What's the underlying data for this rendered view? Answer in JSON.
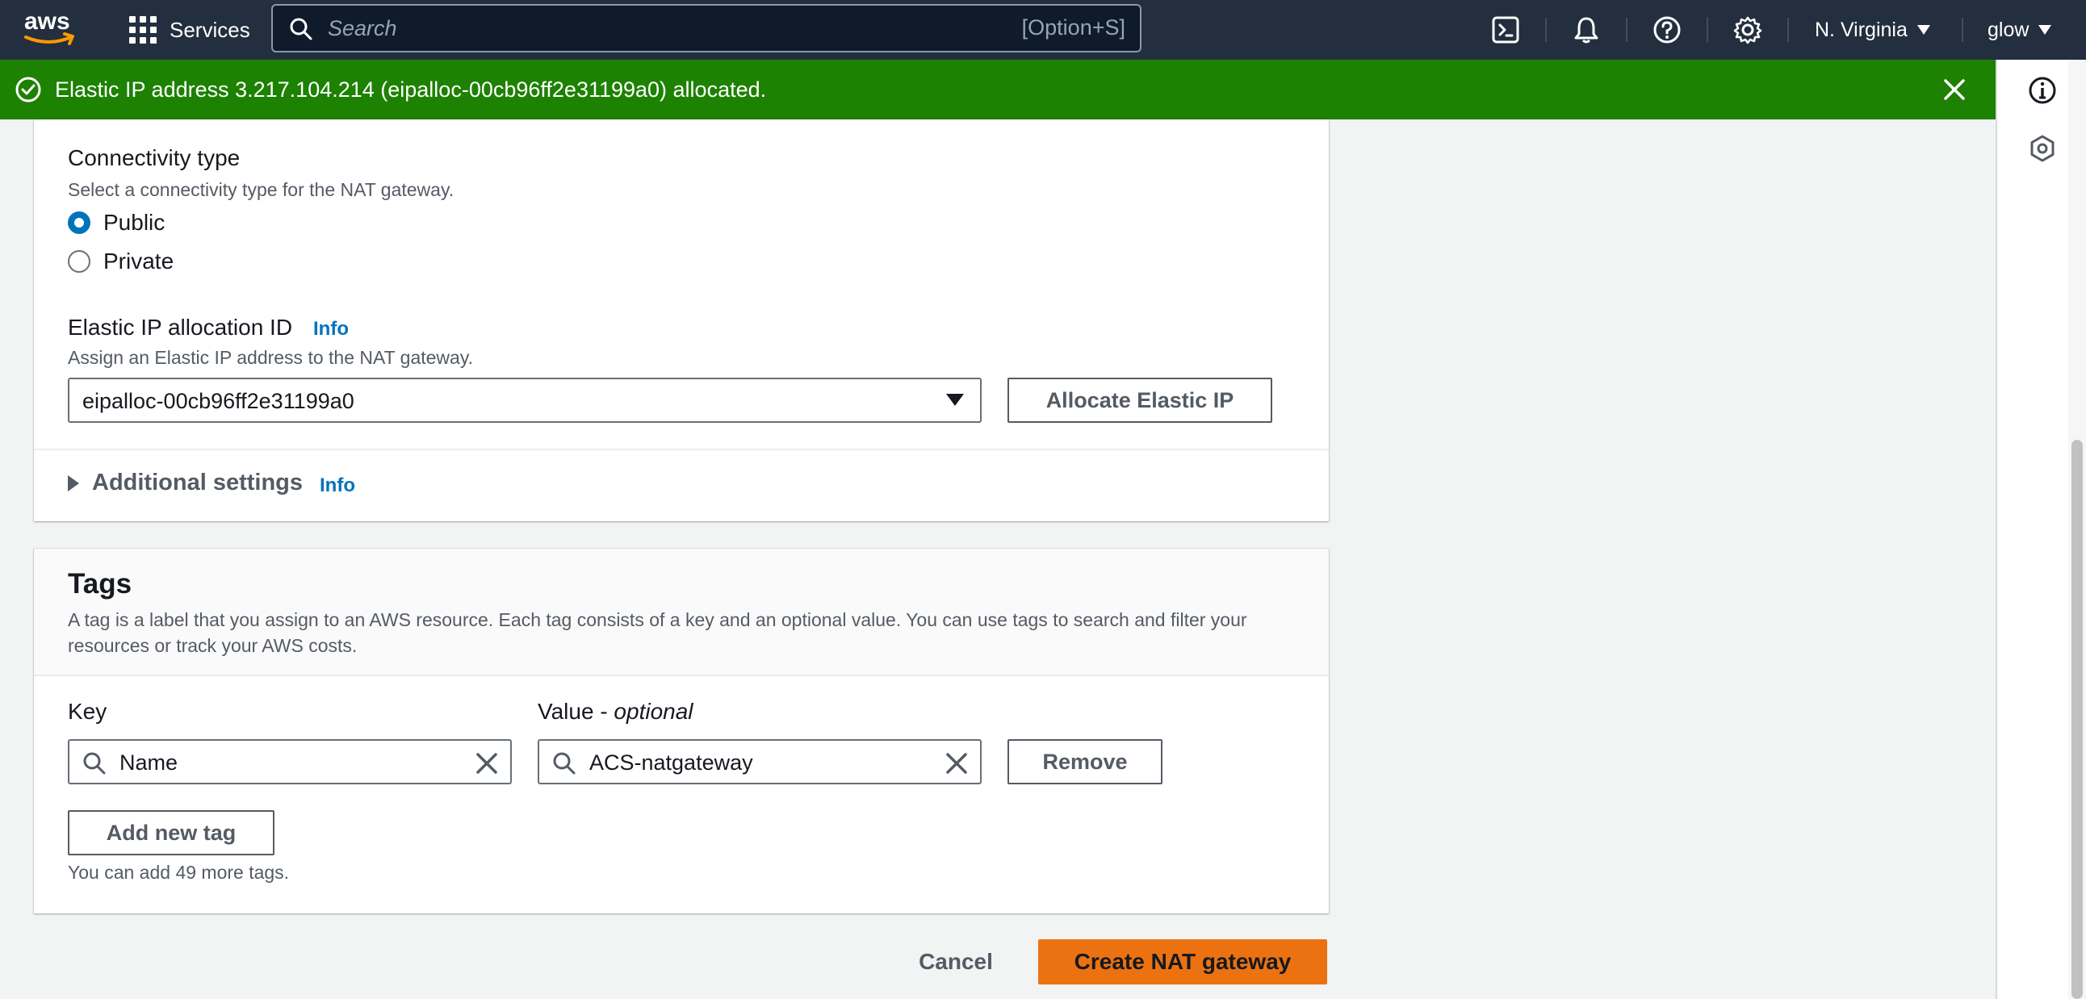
{
  "topnav": {
    "logo_text": "aws",
    "services_label": "Services",
    "search_placeholder": "Search",
    "search_shortcut": "[Option+S]",
    "region_label": "N. Virginia",
    "account_label": "glow",
    "icons": [
      "cloudshell-icon",
      "bell-icon",
      "help-icon",
      "gear-icon"
    ]
  },
  "flash": {
    "message": "Elastic IP address 3.217.104.214 (eipalloc-00cb96ff2e31199a0) allocated.",
    "color": "#1d8102"
  },
  "settings": {
    "connectivity_label": "Connectivity type",
    "connectivity_desc": "Select a connectivity type for the NAT gateway.",
    "options": [
      {
        "label": "Public",
        "checked": true
      },
      {
        "label": "Private",
        "checked": false
      }
    ],
    "eip_label": "Elastic IP allocation ID",
    "eip_info": "Info",
    "eip_desc": "Assign an Elastic IP address to the NAT gateway.",
    "eip_selected": "eipalloc-00cb96ff2e31199a0",
    "allocate_button": "Allocate Elastic IP",
    "additional_label": "Additional settings",
    "additional_info": "Info"
  },
  "tags": {
    "title": "Tags",
    "description": "A tag is a label that you assign to an AWS resource. Each tag consists of a key and an optional value. You can use tags to search and filter your resources or track your AWS costs.",
    "key_label": "Key",
    "value_label": "Value - ",
    "value_optional": "optional",
    "rows": [
      {
        "key": "Name",
        "value": "ACS-natgateway"
      }
    ],
    "remove_button": "Remove",
    "add_button": "Add new tag",
    "hint": "You can add 49 more tags."
  },
  "footer": {
    "cancel": "Cancel",
    "create": "Create NAT gateway",
    "primary_color": "#ec7211"
  }
}
